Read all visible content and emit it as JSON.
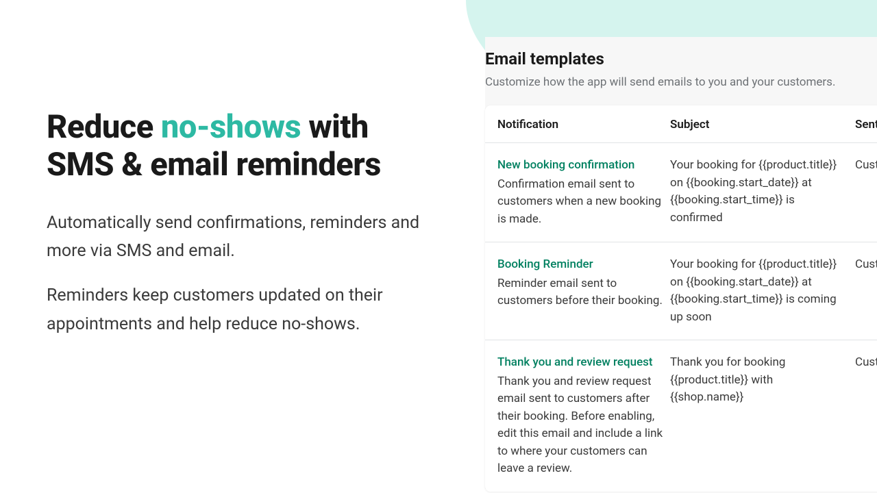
{
  "hero": {
    "headline_pre": "Reduce ",
    "headline_highlight": "no-shows",
    "headline_post": " with SMS & email reminders",
    "para1": "Automatically send confirmations, reminders and more via SMS and email.",
    "para2": "Reminders keep customers updated on their appointments and help reduce no-shows."
  },
  "panel": {
    "title": "Email templates",
    "subtitle": "Customize how the app will send emails to you and your customers.",
    "columns": {
      "notification": "Notification",
      "subject": "Subject",
      "sent": "Sent"
    },
    "rows": [
      {
        "title": "New booking confirmation",
        "desc": "Confirmation email sent to customers when a new booking is made.",
        "subject": "Your booking for {{product.title}} on {{booking.start_date}} at {{booking.start_time}} is confirmed",
        "sent": "Cust"
      },
      {
        "title": "Booking Reminder",
        "desc": "Reminder email sent to customers before their booking.",
        "subject": "Your booking for {{product.title}} on {{booking.start_date}} at {{booking.start_time}} is coming up soon",
        "sent": "Cust"
      },
      {
        "title": "Thank you and review request",
        "desc": "Thank you and review request email sent to customers after their booking. Before enabling, edit this email and include a link to where your customers can leave a review.",
        "subject": "Thank you for booking {{product.title}} with {{shop.name}}",
        "sent": "Cust"
      }
    ]
  }
}
